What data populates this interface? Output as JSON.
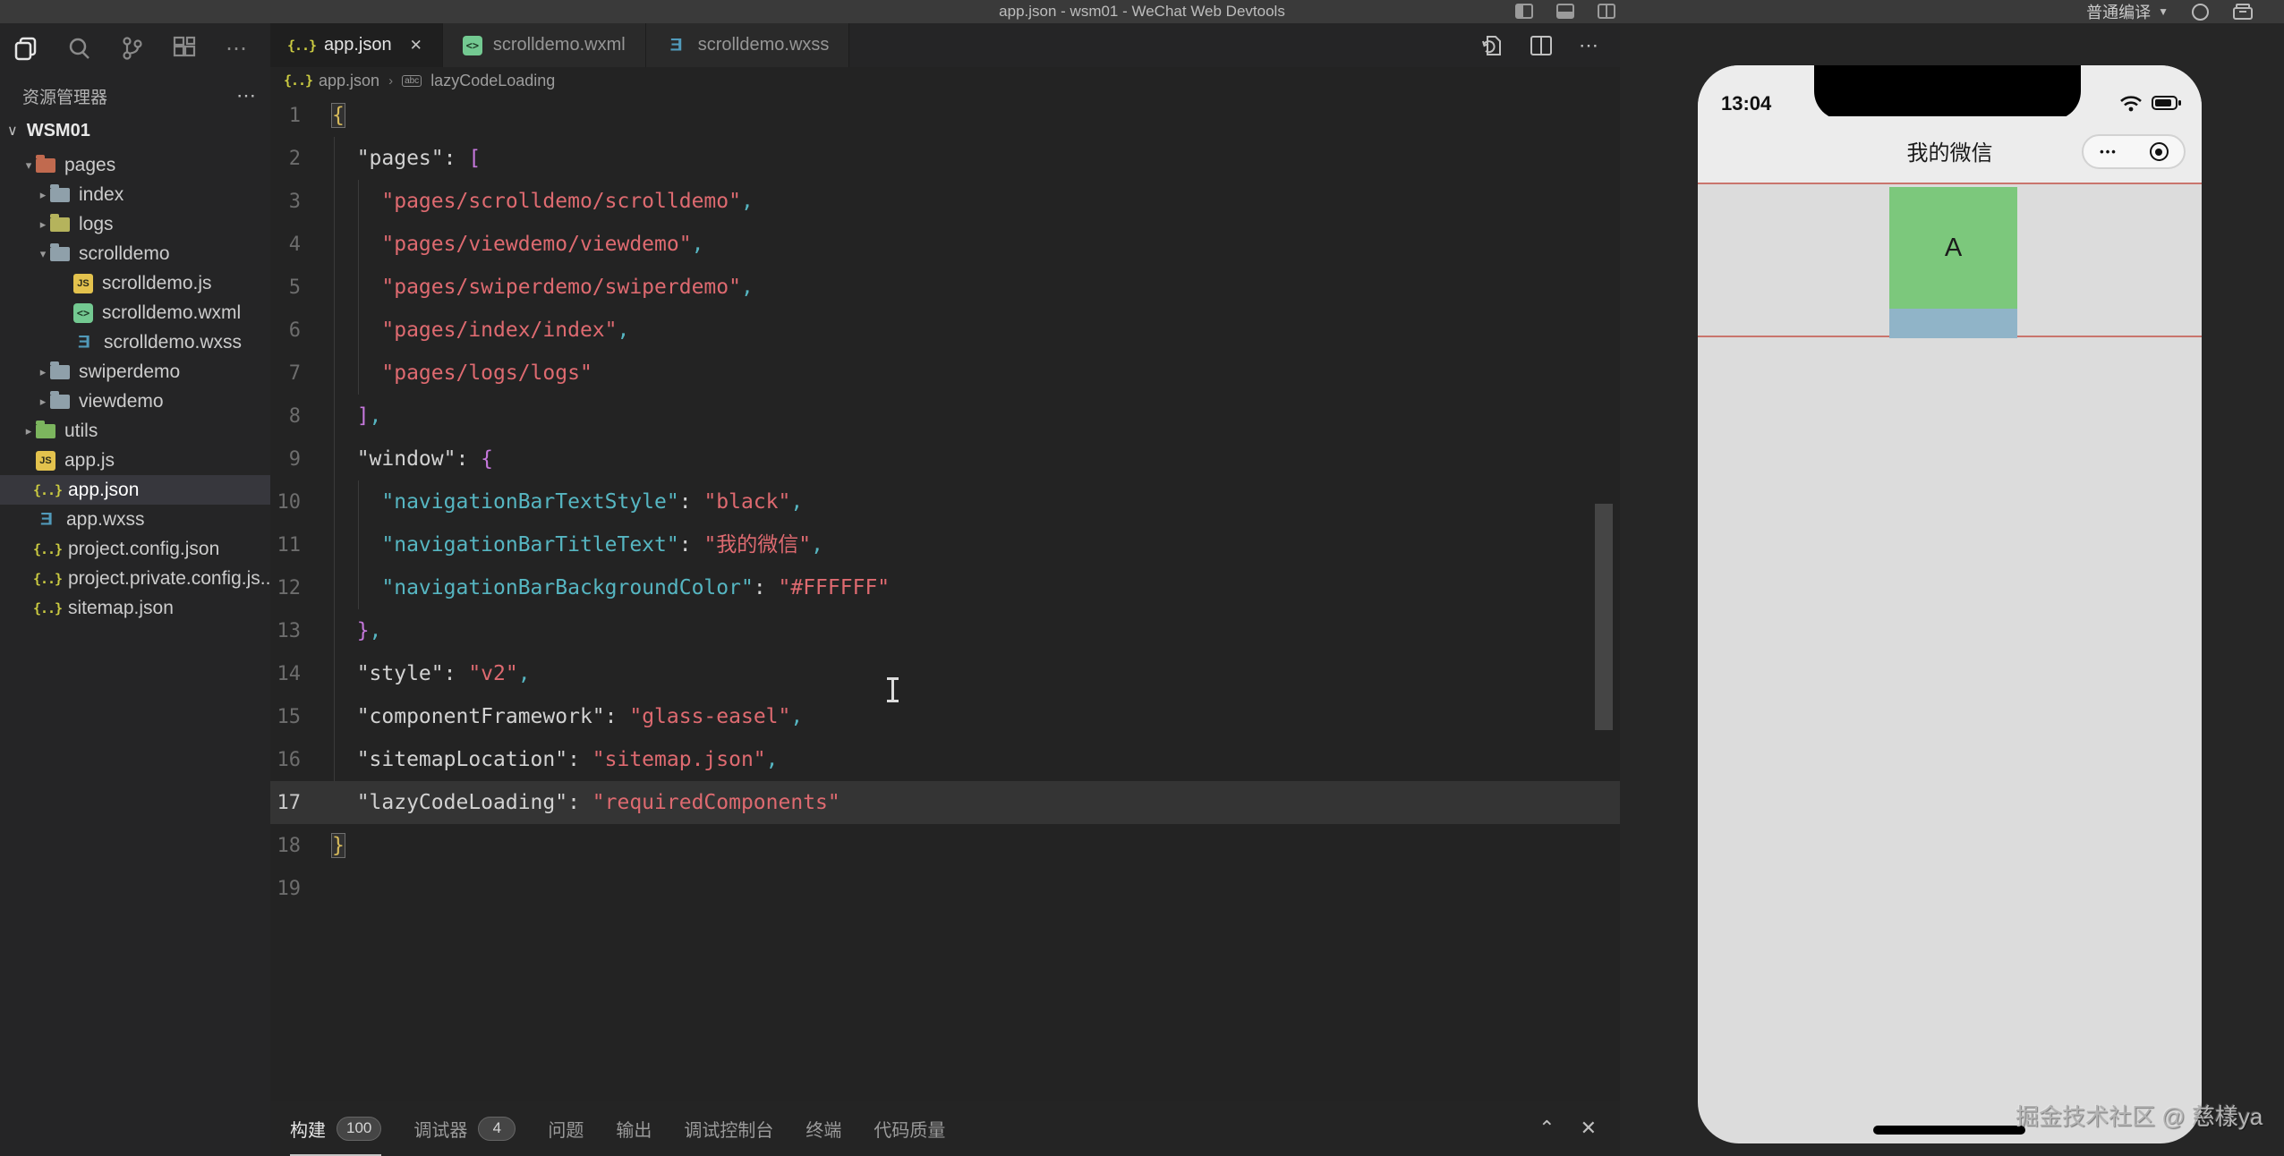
{
  "titlebar": {
    "title": "app.json - wsm01 - WeChat Web Devtools",
    "compile_mode": "普通编译"
  },
  "editor_tabs": [
    {
      "label": "app.json",
      "icon": "json",
      "active": true,
      "close_label": "✕"
    },
    {
      "label": "scrolldemo.wxml",
      "icon": "wxml",
      "active": false
    },
    {
      "label": "scrolldemo.wxss",
      "icon": "wxss",
      "active": false
    }
  ],
  "breadcrumb": {
    "file": "app.json",
    "separator": "›",
    "symbol_icon": "abc",
    "symbol": "lazyCodeLoading"
  },
  "explorer": {
    "header": "资源管理器",
    "more_label": "⋯",
    "root": "WSM01",
    "items": [
      {
        "label": "pages",
        "icon": "fold c-red",
        "depth": 1,
        "arrow": "▾"
      },
      {
        "label": "index",
        "icon": "fold c-slate",
        "depth": 2,
        "arrow": "▸"
      },
      {
        "label": "logs",
        "icon": "fold c-olive",
        "depth": 2,
        "arrow": "▸"
      },
      {
        "label": "scrolldemo",
        "icon": "fold c-slate",
        "depth": 2,
        "arrow": "▾"
      },
      {
        "label": "scrolldemo.js",
        "icon": "js",
        "depth": 3,
        "arrow": ""
      },
      {
        "label": "scrolldemo.wxml",
        "icon": "wxml",
        "depth": 3,
        "arrow": ""
      },
      {
        "label": "scrolldemo.wxss",
        "icon": "wxss",
        "depth": 3,
        "arrow": ""
      },
      {
        "label": "swiperdemo",
        "icon": "fold c-slate",
        "depth": 2,
        "arrow": "▸"
      },
      {
        "label": "viewdemo",
        "icon": "fold c-slate",
        "depth": 2,
        "arrow": "▸"
      },
      {
        "label": "utils",
        "icon": "fold c-green",
        "depth": 1,
        "arrow": "▸"
      },
      {
        "label": "app.js",
        "icon": "js",
        "depth": 1,
        "arrow": ""
      },
      {
        "label": "app.json",
        "icon": "json",
        "depth": 1,
        "arrow": "",
        "selected": true
      },
      {
        "label": "app.wxss",
        "icon": "wxss",
        "depth": 1,
        "arrow": ""
      },
      {
        "label": "project.config.json",
        "icon": "json",
        "depth": 1,
        "arrow": ""
      },
      {
        "label": "project.private.config.js...",
        "icon": "json",
        "depth": 1,
        "arrow": ""
      },
      {
        "label": "sitemap.json",
        "icon": "json",
        "depth": 1,
        "arrow": ""
      }
    ]
  },
  "code": {
    "current_line": 17,
    "lines": [
      {
        "n": 1,
        "match": true,
        "tokens": [
          [
            "g",
            "{"
          ]
        ]
      },
      {
        "n": 2,
        "tokens": [
          [
            "w",
            "  \"pages\": "
          ],
          [
            "m",
            "["
          ]
        ]
      },
      {
        "n": 3,
        "tokens": [
          [
            "s",
            "    \"pages/scrolldemo/scrolldemo\""
          ],
          [
            "c",
            ","
          ]
        ]
      },
      {
        "n": 4,
        "tokens": [
          [
            "s",
            "    \"pages/viewdemo/viewdemo\""
          ],
          [
            "c",
            ","
          ]
        ]
      },
      {
        "n": 5,
        "tokens": [
          [
            "s",
            "    \"pages/swiperdemo/swiperdemo\""
          ],
          [
            "c",
            ","
          ]
        ]
      },
      {
        "n": 6,
        "tokens": [
          [
            "s",
            "    \"pages/index/index\""
          ],
          [
            "c",
            ","
          ]
        ]
      },
      {
        "n": 7,
        "tokens": [
          [
            "s",
            "    \"pages/logs/logs\""
          ]
        ]
      },
      {
        "n": 8,
        "tokens": [
          [
            "m",
            "  ]"
          ],
          [
            "c",
            ","
          ]
        ]
      },
      {
        "n": 9,
        "tokens": [
          [
            "w",
            "  \"window\": "
          ],
          [
            "m",
            "{"
          ]
        ]
      },
      {
        "n": 10,
        "tokens": [
          [
            "c",
            "    \"navigationBarTextStyle\""
          ],
          [
            "w",
            ": "
          ],
          [
            "s",
            "\"black\""
          ],
          [
            "c",
            ","
          ]
        ]
      },
      {
        "n": 11,
        "tokens": [
          [
            "c",
            "    \"navigationBarTitleText\""
          ],
          [
            "w",
            ": "
          ],
          [
            "s",
            "\"我的微信\""
          ],
          [
            "c",
            ","
          ]
        ]
      },
      {
        "n": 12,
        "tokens": [
          [
            "c",
            "    \"navigationBarBackgroundColor\""
          ],
          [
            "w",
            ": "
          ],
          [
            "s",
            "\"#FFFFFF\""
          ]
        ]
      },
      {
        "n": 13,
        "tokens": [
          [
            "m",
            "  }"
          ],
          [
            "c",
            ","
          ]
        ]
      },
      {
        "n": 14,
        "tokens": [
          [
            "w",
            "  \"style\": "
          ],
          [
            "s",
            "\"v2\""
          ],
          [
            "c",
            ","
          ]
        ]
      },
      {
        "n": 15,
        "tokens": [
          [
            "w",
            "  \"componentFramework\": "
          ],
          [
            "s",
            "\"glass-easel\""
          ],
          [
            "c",
            ","
          ]
        ]
      },
      {
        "n": 16,
        "tokens": [
          [
            "w",
            "  \"sitemapLocation\": "
          ],
          [
            "s",
            "\"sitemap.json\""
          ],
          [
            "c",
            ","
          ]
        ]
      },
      {
        "n": 17,
        "tokens": [
          [
            "w",
            "  \"lazyCodeLoading\": "
          ],
          [
            "s",
            "\"requiredComponents\""
          ]
        ]
      },
      {
        "n": 18,
        "match": true,
        "tokens": [
          [
            "g",
            "}"
          ]
        ]
      },
      {
        "n": 19,
        "tokens": []
      }
    ]
  },
  "panel": {
    "tabs": [
      {
        "label": "构建",
        "badge": "100",
        "active": true
      },
      {
        "label": "调试器",
        "badge": "4"
      },
      {
        "label": "问题"
      },
      {
        "label": "输出"
      },
      {
        "label": "调试控制台"
      },
      {
        "label": "终端"
      },
      {
        "label": "代码质量"
      }
    ],
    "collapse_label": "⌃",
    "close_label": "✕"
  },
  "simulator": {
    "time": "13:04",
    "nav_title": "我的微信",
    "capsule_dots": "●●●",
    "box_label": "A",
    "watermark": "掘金技术社区 @ 慈樣ya"
  },
  "colors": {
    "string": "#de6a70",
    "key_nested": "#56b6c2",
    "bracket_inner": "#c678dd",
    "bracket_outer": "#d7ba5b",
    "border_red": "#c9756d",
    "box_green": "#7cc87c",
    "box_blue": "#90b4c8",
    "selected_row": "#37373d"
  }
}
